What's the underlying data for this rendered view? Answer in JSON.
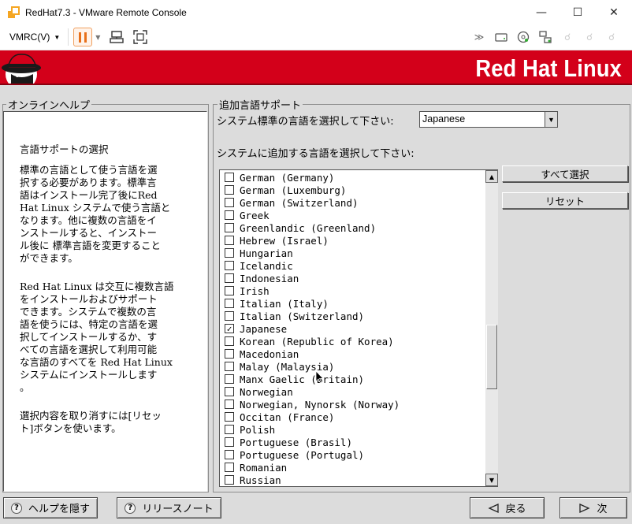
{
  "window": {
    "title": "RedHat7.3 - VMware Remote Console",
    "minimize_glyph": "—",
    "maximize_glyph": "☐",
    "close_glyph": "✕"
  },
  "toolbar": {
    "menu_label": "VMRC(V)",
    "icons": [
      "pause-icon",
      "send-keys-icon",
      "fullscreen-icon",
      "forward-icon",
      "disk-icon",
      "cd-icon",
      "network-icon",
      "usb-icon",
      "printer-icon",
      "sound-icon"
    ]
  },
  "banner": {
    "brand": "Red Hat Linux",
    "colors": {
      "red": "#d3001a"
    }
  },
  "help": {
    "legend": "オンラインヘルプ",
    "title": "言語サポートの選択",
    "paragraph1": "標準の言語として使う言語を選\n択する必要があります。標準言\n語はインストール完了後にRed\nHat Linux システムで使う言語と\nなります。他に複数の言語をイ\nンストールすると、インストー\nル後に 標準言語を変更すること\nができます。",
    "paragraph2": "Red Hat Linux は交互に複数言語\nをインストールおよびサポート\nできます。システムで複数の言\n語を使うには、特定の言語を選\n択してインストールするか、す\nべての言語を選択して利用可能\nな言語のすべてを Red Hat Linux\nシステムにインストールします\n。",
    "paragraph3": "選択内容を取り消すには[リセッ\nト]ボタンを使います。"
  },
  "lang": {
    "legend": "追加言語サポート",
    "default_label": "システム標準の言語を選択して下さい:",
    "default_value": "Japanese",
    "additional_label": "システムに追加する言語を選択して下さい:",
    "select_all": "すべて選択",
    "reset": "リセット",
    "check_glyph": "✓",
    "items": [
      {
        "label": "German (Germany)",
        "checked": false
      },
      {
        "label": "German (Luxemburg)",
        "checked": false
      },
      {
        "label": "German (Switzerland)",
        "checked": false
      },
      {
        "label": "Greek",
        "checked": false
      },
      {
        "label": "Greenlandic (Greenland)",
        "checked": false
      },
      {
        "label": "Hebrew (Israel)",
        "checked": false
      },
      {
        "label": "Hungarian",
        "checked": false
      },
      {
        "label": "Icelandic",
        "checked": false
      },
      {
        "label": "Indonesian",
        "checked": false
      },
      {
        "label": "Irish",
        "checked": false
      },
      {
        "label": "Italian (Italy)",
        "checked": false
      },
      {
        "label": "Italian (Switzerland)",
        "checked": false
      },
      {
        "label": "Japanese",
        "checked": true
      },
      {
        "label": "Korean (Republic of Korea)",
        "checked": false
      },
      {
        "label": "Macedonian",
        "checked": false
      },
      {
        "label": "Malay (Malaysia)",
        "checked": false
      },
      {
        "label": "Manx Gaelic (Britain)",
        "checked": false
      },
      {
        "label": "Norwegian",
        "checked": false
      },
      {
        "label": "Norwegian, Nynorsk (Norway)",
        "checked": false
      },
      {
        "label": "Occitan (France)",
        "checked": false
      },
      {
        "label": "Polish",
        "checked": false
      },
      {
        "label": "Portuguese (Brasil)",
        "checked": false
      },
      {
        "label": "Portuguese (Portugal)",
        "checked": false
      },
      {
        "label": "Romanian",
        "checked": false
      },
      {
        "label": "Russian",
        "checked": false
      }
    ]
  },
  "buttons": {
    "hide_help": "ヘルプを隠す",
    "release_notes": "リリースノート",
    "back": "戻る",
    "next": "次"
  }
}
